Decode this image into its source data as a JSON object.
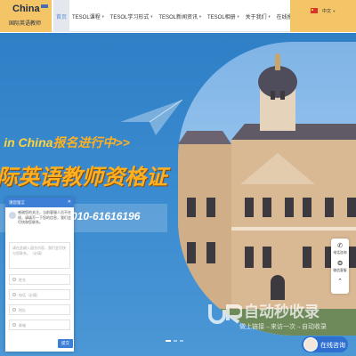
{
  "header": {
    "logo_main": "China",
    "logo_sub": "国际英语教师",
    "nav": [
      {
        "label": "首页",
        "active": true,
        "dropdown": false
      },
      {
        "label": "TESOL课程",
        "active": false,
        "dropdown": true
      },
      {
        "label": "TESOL学习形式",
        "active": false,
        "dropdown": true
      },
      {
        "label": "TESOL新闻资讯",
        "active": false,
        "dropdown": true
      },
      {
        "label": "TESOL相册",
        "active": false,
        "dropdown": true
      },
      {
        "label": "关于我们",
        "active": false,
        "dropdown": true
      },
      {
        "label": "在线报",
        "active": false,
        "dropdown": false
      }
    ],
    "language": "中文",
    "accent_color": "#f3c567"
  },
  "hero": {
    "line1_prefix": "L in China",
    "line1_suffix": "报名进行中>>",
    "line2": "际英语教师资格证",
    "phone": "010-61616196",
    "slides": 3,
    "active_slide": 1
  },
  "chat": {
    "title": "请您留言",
    "close_icon": "close-icon",
    "message": "感谢您的关注，当前客服人员不在线，请填写一下您的信息，我们会尽快和您联系。",
    "textarea_placeholder": "请在此输入留言内容，我们会尽快与您联系。（必填）",
    "fields": [
      {
        "icon": "user-icon",
        "placeholder": "姓名"
      },
      {
        "icon": "phone-icon",
        "placeholder": "电话（必填）"
      },
      {
        "icon": "location-icon",
        "placeholder": "地址"
      },
      {
        "icon": "email-icon",
        "placeholder": "邮箱"
      }
    ],
    "submit": "提交",
    "brand_color": "#3b7fd6"
  },
  "sidebar": [
    {
      "icon": "phone-icon",
      "label": "电话咨询"
    },
    {
      "icon": "wechat-icon",
      "label": "微信客服"
    }
  ],
  "watermark": {
    "title": "自动秒收录",
    "subtitle": "做上链接→来访一次→自动收录"
  },
  "consult": {
    "label": "在线咨询"
  }
}
